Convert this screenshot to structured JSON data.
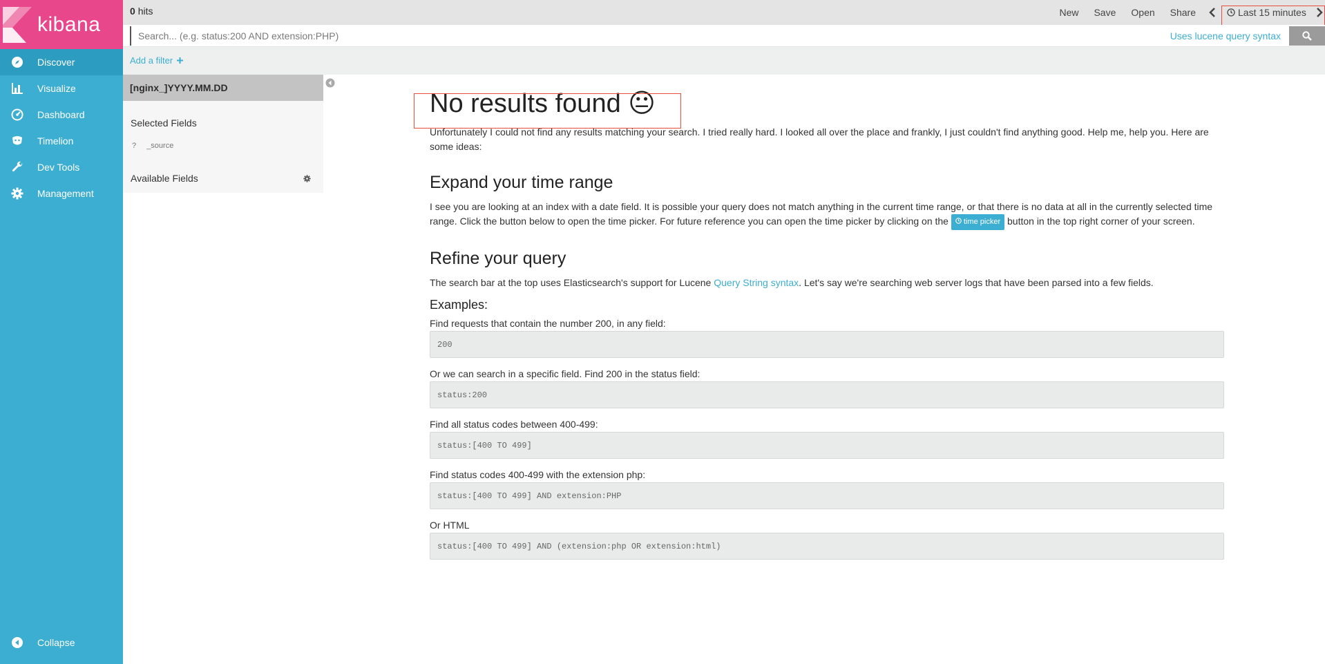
{
  "app": {
    "logo_text": "kibana"
  },
  "sidebar": {
    "items": [
      {
        "label": "Discover",
        "icon": "compass-icon"
      },
      {
        "label": "Visualize",
        "icon": "bar-chart-icon"
      },
      {
        "label": "Dashboard",
        "icon": "dashboard-gauge-icon"
      },
      {
        "label": "Timelion",
        "icon": "timelion-icon"
      },
      {
        "label": "Dev Tools",
        "icon": "wrench-icon"
      },
      {
        "label": "Management",
        "icon": "gear-icon"
      }
    ],
    "collapse_label": "Collapse"
  },
  "topbar": {
    "hits_count": "0",
    "hits_label": "hits",
    "new_label": "New",
    "save_label": "Save",
    "open_label": "Open",
    "share_label": "Share",
    "time_range": "Last 15 minutes"
  },
  "search": {
    "placeholder": "Search... (e.g. status:200 AND extension:PHP)",
    "value": "",
    "lucene_label": "Uses lucene query syntax"
  },
  "filter": {
    "add_label": "Add a filter"
  },
  "fields": {
    "index_pattern": "[nginx_]YYYY.MM.DD",
    "selected_title": "Selected Fields",
    "source_type": "?",
    "source_name": "_source",
    "available_title": "Available Fields"
  },
  "main": {
    "title": "No results found 😐",
    "intro": "Unfortunately I could not find any results matching your search. I tried really hard. I looked all over the place and frankly, I just couldn't find anything good. Help me, help you. Here are some ideas:",
    "expand_title": "Expand your time range",
    "expand_text_1": "I see you are looking at an index with a date field. It is possible your query does not match anything in the current time range, or that there is no data at all in the currently selected time range. Click the button below to open the time picker. For future reference you can open the time picker by clicking on the",
    "time_picker_label": "time picker",
    "expand_text_2": "button in the top right corner of your screen.",
    "refine_title": "Refine your query",
    "refine_text_1": "The search bar at the top uses Elasticsearch's support for Lucene",
    "refine_link": "Query String syntax",
    "refine_text_2": ". Let's say we're searching web server logs that have been parsed into a few fields.",
    "examples_title": "Examples:",
    "examples": [
      {
        "label": "Find requests that contain the number 200, in any field:",
        "code": "200"
      },
      {
        "label": "Or we can search in a specific field. Find 200 in the status field:",
        "code": "status:200"
      },
      {
        "label": "Find all status codes between 400-499:",
        "code": "status:[400 TO 499]"
      },
      {
        "label": "Find status codes 400-499 with the extension php:",
        "code": "status:[400 TO 499] AND extension:PHP"
      },
      {
        "label": "Or HTML",
        "code": "status:[400 TO 499] AND (extension:php OR extension:html)"
      }
    ]
  },
  "colors": {
    "sidebar_bg": "#3caed2",
    "logo_bg": "#e8478b",
    "accent": "#3caed2",
    "annotation_red": "#e74c3c"
  }
}
